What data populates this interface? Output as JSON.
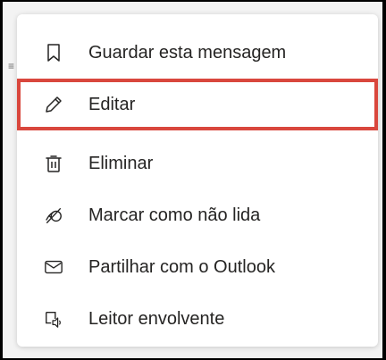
{
  "background": {
    "glyph": "≡"
  },
  "menu": {
    "items": [
      {
        "label": "Guardar esta mensagem",
        "icon": "bookmark-icon"
      },
      {
        "label": "Editar",
        "icon": "pencil-icon"
      },
      {
        "label": "Eliminar",
        "icon": "trash-icon"
      },
      {
        "label": "Marcar como não lida",
        "icon": "mark-unread-icon"
      },
      {
        "label": "Partilhar com o Outlook",
        "icon": "mail-icon"
      },
      {
        "label": "Leitor envolvente",
        "icon": "immersive-reader-icon"
      }
    ]
  },
  "colors": {
    "highlight": "#d9473d",
    "text": "#252423",
    "icon": "#252423"
  }
}
